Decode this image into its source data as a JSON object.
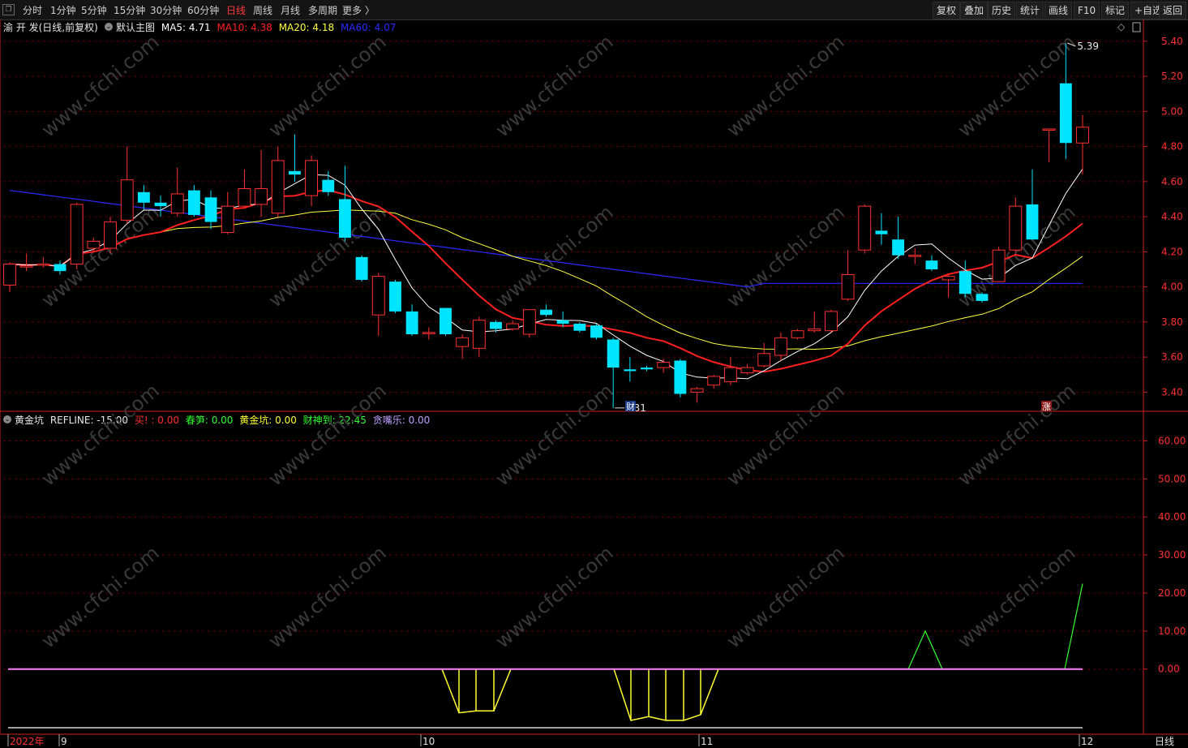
{
  "toolbar": {
    "icon": "square-icon",
    "periods": [
      {
        "label": "分时",
        "active": false
      },
      {
        "label": "1分钟",
        "active": false
      },
      {
        "label": "5分钟",
        "active": false
      },
      {
        "label": "15分钟",
        "active": false
      },
      {
        "label": "30分钟",
        "active": false
      },
      {
        "label": "60分钟",
        "active": false
      },
      {
        "label": "日线",
        "active": true
      },
      {
        "label": "周线",
        "active": false
      },
      {
        "label": "月线",
        "active": false
      },
      {
        "label": "多周期",
        "active": false
      },
      {
        "label": "更多 〉",
        "active": false
      }
    ],
    "right": [
      "复权",
      "叠加",
      "历史",
      "统计",
      "画线",
      "F10",
      "标记",
      "+自选",
      "返回"
    ]
  },
  "main_legend": {
    "stock": "渝 开 发(日线,前复权)",
    "template": "默认主图",
    "ma5": {
      "label": "MA5: 4.71",
      "color": "#ffffff"
    },
    "ma10": {
      "label": "MA10: 4.38",
      "color": "#ff2020"
    },
    "ma20": {
      "label": "MA20: 4.18",
      "color": "#ffff40"
    },
    "ma60": {
      "label": "MA60: 4.07",
      "color": "#2a2aff"
    }
  },
  "sub_legend": {
    "name": "黄金坑",
    "refline": "REFLINE: -15.00",
    "buy": {
      "label": "买! : 0.00",
      "color": "#ff3030"
    },
    "chunsun": {
      "label": "春笋: 0.00",
      "color": "#30ff30"
    },
    "huangjinkeng": {
      "label": "黄金坑: 0.00",
      "color": "#ffff30"
    },
    "caishen": {
      "label": "财神到: 22.45",
      "color": "#30ff30"
    },
    "tanzui": {
      "label": "贪嘴乐: 0.00",
      "color": "#c0a0ff"
    }
  },
  "annotations": {
    "high": "5.39",
    "low": "3.31",
    "marker_cai": "财",
    "marker_zhang": "涨"
  },
  "watermark": "www.cfchi.com",
  "bottom_axis": {
    "labels": [
      "2022年",
      "9",
      "10",
      "11",
      "12"
    ],
    "period": "日线"
  },
  "colors": {
    "up": "#ff3030",
    "down": "#00e5ff",
    "grid": "#5a0000",
    "axis": "#cc2020"
  },
  "chart_data": [
    {
      "type": "candlestick",
      "title": "渝 开 发(日线,前复权)",
      "ylim": [
        3.3,
        5.45
      ],
      "yticks": [
        3.4,
        3.6,
        3.8,
        4.0,
        4.2,
        4.4,
        4.6,
        4.8,
        5.0,
        5.2,
        5.4
      ],
      "candles": [
        [
          4.01,
          4.13,
          4.14,
          3.97
        ],
        [
          4.12,
          4.12,
          4.19,
          4.09
        ],
        [
          4.13,
          4.13,
          4.17,
          4.11
        ],
        [
          4.13,
          4.09,
          4.15,
          4.07
        ],
        [
          4.13,
          4.47,
          4.48,
          4.1
        ],
        [
          4.22,
          4.26,
          4.28,
          4.2
        ],
        [
          4.22,
          4.37,
          4.4,
          4.19
        ],
        [
          4.38,
          4.61,
          4.8,
          4.36
        ],
        [
          4.54,
          4.48,
          4.58,
          4.44
        ],
        [
          4.48,
          4.46,
          4.52,
          4.4
        ],
        [
          4.42,
          4.53,
          4.68,
          4.4
        ],
        [
          4.55,
          4.41,
          4.58,
          4.4
        ],
        [
          4.51,
          4.37,
          4.55,
          4.33
        ],
        [
          4.31,
          4.46,
          4.54,
          4.3
        ],
        [
          4.46,
          4.56,
          4.67,
          4.45
        ],
        [
          4.47,
          4.56,
          4.78,
          4.4
        ],
        [
          4.42,
          4.72,
          4.8,
          4.4
        ],
        [
          4.66,
          4.64,
          4.87,
          4.6
        ],
        [
          4.52,
          4.72,
          4.75,
          4.46
        ],
        [
          4.61,
          4.54,
          4.66,
          4.52
        ],
        [
          4.5,
          4.28,
          4.69,
          4.26
        ],
        [
          4.17,
          4.04,
          4.18,
          4.03
        ],
        [
          3.84,
          4.06,
          4.08,
          3.72
        ],
        [
          4.03,
          3.86,
          4.04,
          3.85
        ],
        [
          3.86,
          3.73,
          3.9,
          3.72
        ],
        [
          3.74,
          3.74,
          3.77,
          3.7
        ],
        [
          3.88,
          3.73,
          3.88,
          3.72
        ],
        [
          3.66,
          3.71,
          3.73,
          3.59
        ],
        [
          3.65,
          3.81,
          3.83,
          3.6
        ],
        [
          3.8,
          3.76,
          3.81,
          3.74
        ],
        [
          3.76,
          3.79,
          3.81,
          3.75
        ],
        [
          3.73,
          3.87,
          3.87,
          3.71
        ],
        [
          3.87,
          3.84,
          3.9,
          3.83
        ],
        [
          3.81,
          3.79,
          3.86,
          3.77
        ],
        [
          3.79,
          3.75,
          3.8,
          3.74
        ],
        [
          3.78,
          3.71,
          3.79,
          3.7
        ],
        [
          3.7,
          3.54,
          3.71,
          3.31
        ],
        [
          3.53,
          3.52,
          3.6,
          3.46
        ],
        [
          3.54,
          3.53,
          3.55,
          3.52
        ],
        [
          3.54,
          3.57,
          3.59,
          3.51
        ],
        [
          3.58,
          3.39,
          3.59,
          3.37
        ],
        [
          3.4,
          3.42,
          3.43,
          3.34
        ],
        [
          3.44,
          3.49,
          3.5,
          3.42
        ],
        [
          3.46,
          3.54,
          3.6,
          3.44
        ],
        [
          3.51,
          3.54,
          3.56,
          3.5
        ],
        [
          3.55,
          3.62,
          3.68,
          3.54
        ],
        [
          3.61,
          3.71,
          3.74,
          3.58
        ],
        [
          3.71,
          3.75,
          3.76,
          3.7
        ],
        [
          3.75,
          3.76,
          3.86,
          3.74
        ],
        [
          3.75,
          3.86,
          3.87,
          3.74
        ],
        [
          3.93,
          4.07,
          4.21,
          3.92
        ],
        [
          4.21,
          4.46,
          4.47,
          4.19
        ],
        [
          4.32,
          4.3,
          4.42,
          4.24
        ],
        [
          4.27,
          4.18,
          4.4,
          4.16
        ],
        [
          4.18,
          4.18,
          4.22,
          4.13
        ],
        [
          4.15,
          4.1,
          4.18,
          4.09
        ],
        [
          4.04,
          4.06,
          4.07,
          3.94
        ],
        [
          4.09,
          3.96,
          4.15,
          3.94
        ],
        [
          3.96,
          3.92,
          3.97,
          3.91
        ],
        [
          4.03,
          4.21,
          4.23,
          4.03
        ],
        [
          4.21,
          4.46,
          4.51,
          4.2
        ],
        [
          4.47,
          4.27,
          4.67,
          4.27
        ],
        [
          4.9,
          4.9,
          4.9,
          4.71
        ],
        [
          5.16,
          4.82,
          5.39,
          4.73
        ],
        [
          4.82,
          4.91,
          4.98,
          4.64
        ]
      ]
    },
    {
      "type": "line",
      "title": "黄金坑",
      "ylim": [
        -15,
        65
      ],
      "yticks": [
        0,
        10,
        20,
        30,
        40,
        50,
        60
      ],
      "series": [
        {
          "name": "财神到",
          "color": "#30ff30",
          "values": [
            0,
            0,
            0,
            0,
            0,
            0,
            0,
            0,
            0,
            0,
            0,
            0,
            0,
            0,
            0,
            0,
            0,
            0,
            0,
            0,
            0,
            0,
            0,
            0,
            0,
            0,
            0,
            0,
            0,
            0,
            0,
            0,
            0,
            0,
            0,
            0,
            0,
            0,
            0,
            0,
            0,
            0,
            0,
            0,
            0,
            0,
            0,
            0,
            0,
            0,
            0,
            0,
            0,
            0,
            0,
            0,
            0,
            0,
            0,
            0,
            0,
            0,
            0,
            0,
            0,
            0,
            0,
            0,
            0,
            0,
            0,
            0,
            0,
            0,
            0,
            0,
            0,
            0,
            0,
            0,
            0,
            0,
            0,
            0,
            0,
            0,
            0,
            0,
            0,
            0,
            0,
            0,
            0,
            0,
            0,
            0,
            0,
            0,
            0,
            0,
            0,
            0,
            0,
            0,
            0,
            0,
            0,
            0,
            0,
            0,
            0,
            0,
            0,
            0,
            0,
            0,
            0,
            0,
            0,
            0,
            0,
            0,
            0,
            0,
            0,
            0,
            0,
            0,
            0,
            0,
            0,
            0,
            0,
            0,
            0,
            0,
            0,
            0,
            0,
            0,
            0,
            0,
            0,
            0,
            0,
            0,
            0,
            0,
            0,
            0,
            0,
            0,
            0,
            0,
            0,
            0,
            0,
            0,
            0,
            0,
            0,
            0,
            0,
            0,
            0,
            0,
            0,
            0,
            0,
            0,
            0,
            0,
            0,
            0,
            0,
            0,
            0,
            0,
            0,
            0,
            0,
            0,
            0,
            0,
            0,
            0,
            0,
            0,
            0,
            0,
            0,
            0,
            0,
            0,
            0,
            0,
            0,
            0,
            0,
            0,
            0,
            0,
            0,
            0,
            0,
            0,
            0,
            0,
            0,
            0,
            0,
            0,
            0,
            0,
            0,
            0
          ]
        },
        {
          "name": "黄金坑",
          "color": "#ffff30",
          "values": []
        }
      ]
    }
  ]
}
